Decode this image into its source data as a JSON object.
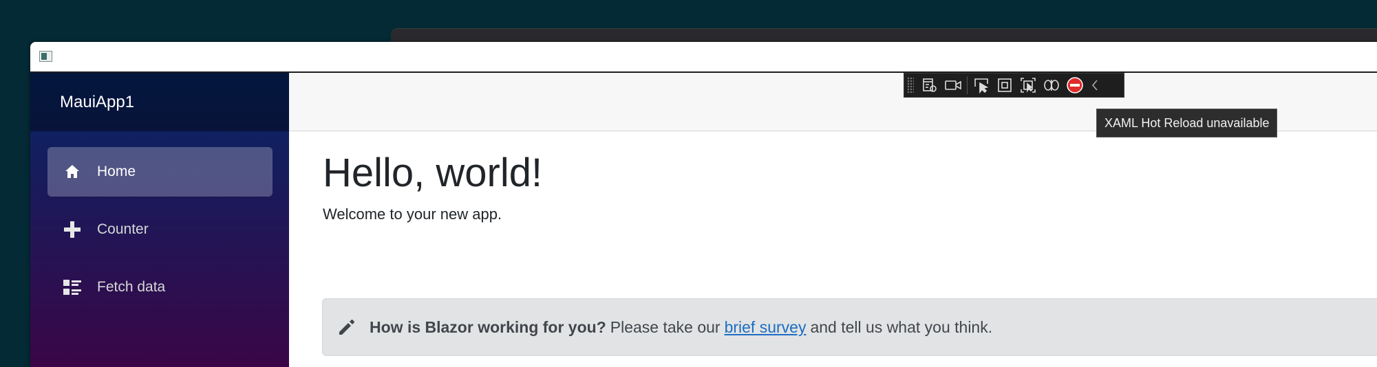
{
  "app": {
    "brand": "MauiApp1"
  },
  "nav": {
    "items": [
      {
        "label": "Home",
        "icon": "home-icon",
        "active": true
      },
      {
        "label": "Counter",
        "icon": "plus-icon",
        "active": false
      },
      {
        "label": "Fetch data",
        "icon": "list-rich-icon",
        "active": false
      }
    ]
  },
  "page": {
    "title": "Hello, world!",
    "welcome": "Welcome to your new app."
  },
  "survey": {
    "question": "How is Blazor working for you?",
    "prefix": "Please take our",
    "link": "brief survey",
    "suffix": "and tell us what you think."
  },
  "hot_reload_toolbar": {
    "tooltip": "XAML Hot Reload unavailable",
    "buttons": [
      "live-visual-tree-icon",
      "video-camera-icon",
      "select-element-icon",
      "display-layout-adorners-icon",
      "track-focused-element-icon",
      "binding-failures-icon",
      "hot-reload-unavailable-icon",
      "collapse-toolbar-icon"
    ]
  },
  "colors": {
    "sidebar_top": "#052767",
    "sidebar_bottom": "#3a0647",
    "link": "#1b6ec2",
    "alert_bg": "#e2e3e5"
  }
}
